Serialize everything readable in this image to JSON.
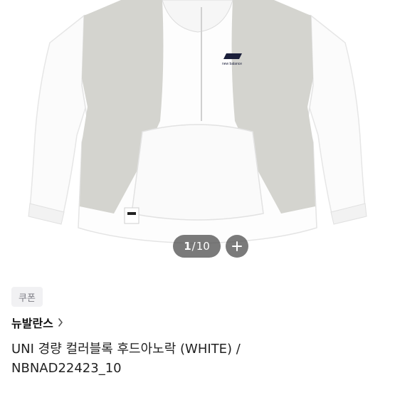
{
  "gallery": {
    "current": "1",
    "separator": "/",
    "total": "10",
    "jacket_color": "#ffffff",
    "panel_color": "#d4d4cf",
    "logo_text": "new balance"
  },
  "product": {
    "coupon_label": "쿠폰",
    "brand": "뉴발란스",
    "title": "UNI 경량 컬러블록 후드아노락 (WHITE) /\nNBNAD22423_10"
  }
}
